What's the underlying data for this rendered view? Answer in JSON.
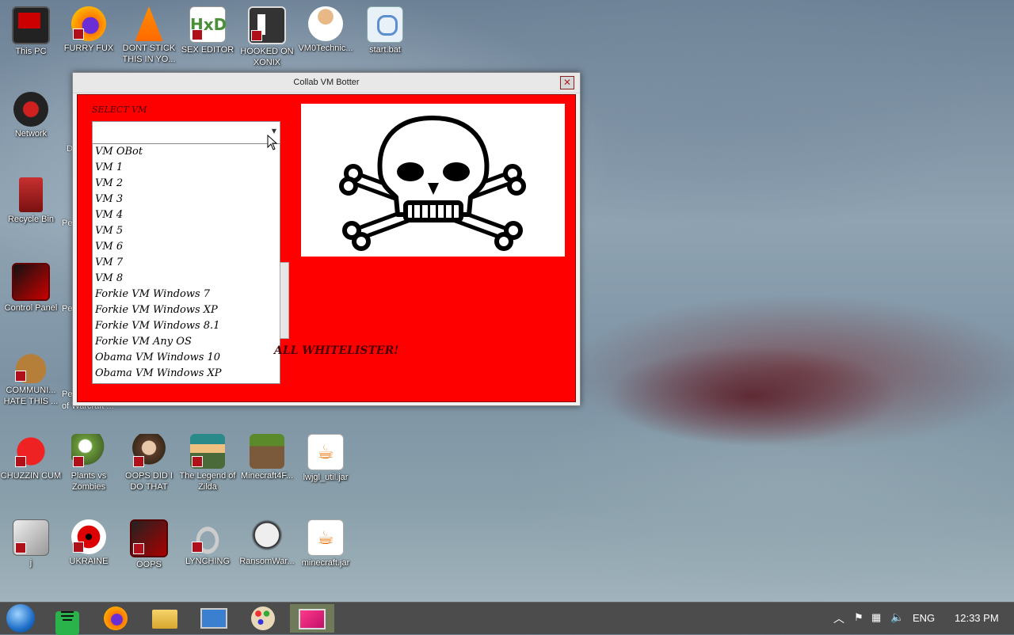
{
  "desktop": {
    "icons": [
      {
        "label": "This PC"
      },
      {
        "label": "FURRY FUX"
      },
      {
        "label": "DONT STICK THIS IN YO..."
      },
      {
        "label": "SEX EDITOR"
      },
      {
        "label": "HOOKED ON XONIX"
      },
      {
        "label": "VM0Technic..."
      },
      {
        "label": "start.bat"
      },
      {
        "label": "Network"
      },
      {
        "label": "Recycle Bin"
      },
      {
        "label": "Control Panel"
      },
      {
        "label": "COMMUNI... HATE THIS ..."
      },
      {
        "label": "CHUZZIN CUM"
      },
      {
        "label": "Plants vs Zombies"
      },
      {
        "label": "OOPS DID I DO THAT"
      },
      {
        "label": "The Legend of Zilda"
      },
      {
        "label": "Minecraft4F..."
      },
      {
        "label": "lwjgl_util.jar"
      },
      {
        "label": "j"
      },
      {
        "label": "UKRAINE"
      },
      {
        "label": "OOPS"
      },
      {
        "label": "LYNCHING"
      },
      {
        "label": "RansomWar..."
      },
      {
        "label": "minecraft.jar"
      }
    ],
    "partial_labels": [
      "D",
      "Pe",
      "Pe",
      "Pe",
      "Pe",
      "of Warcraft ..."
    ]
  },
  "window": {
    "title": "Collab VM Botter",
    "close_label": "✕",
    "select_label": "SELECT VM",
    "selected_value": "",
    "options": [
      "VM OBot",
      "VM 1",
      "VM 2",
      "VM 3",
      "VM 4",
      "VM 5",
      "VM 6",
      "VM 7",
      "VM 8",
      "Forkie VM Windows 7",
      "Forkie VM Windows XP",
      "Forkie VM Windows 8.1",
      "Forkie VM Any OS",
      "Obama VM Windows 10",
      "Obama VM Windows XP"
    ],
    "whitelister_text": "ALL WHITELISTER!",
    "image_icon": "skull-crossbones-icon"
  },
  "taskbar": {
    "items": [
      "start-orb-icon",
      "notes-app-icon",
      "firefox-icon",
      "file-explorer-icon",
      "computer-icon",
      "paint-icon",
      "screen-app-icon"
    ],
    "language": "ENG",
    "time": "12:33 PM"
  },
  "colors": {
    "window_body": "#ff0000",
    "taskbar": "#4c4c4c"
  }
}
